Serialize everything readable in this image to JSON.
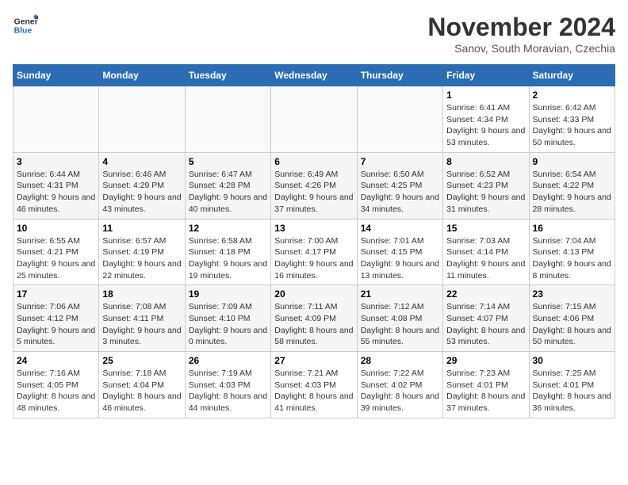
{
  "logo": {
    "general": "General",
    "blue": "Blue"
  },
  "title": "November 2024",
  "subtitle": "Sanov, South Moravian, Czechia",
  "days_of_week": [
    "Sunday",
    "Monday",
    "Tuesday",
    "Wednesday",
    "Thursday",
    "Friday",
    "Saturday"
  ],
  "weeks": [
    [
      {
        "day": "",
        "empty": true
      },
      {
        "day": "",
        "empty": true
      },
      {
        "day": "",
        "empty": true
      },
      {
        "day": "",
        "empty": true
      },
      {
        "day": "",
        "empty": true
      },
      {
        "day": "1",
        "sunrise": "6:41 AM",
        "sunset": "4:34 PM",
        "daylight": "9 hours and 53 minutes."
      },
      {
        "day": "2",
        "sunrise": "6:42 AM",
        "sunset": "4:33 PM",
        "daylight": "9 hours and 50 minutes."
      }
    ],
    [
      {
        "day": "3",
        "sunrise": "6:44 AM",
        "sunset": "4:31 PM",
        "daylight": "9 hours and 46 minutes."
      },
      {
        "day": "4",
        "sunrise": "6:46 AM",
        "sunset": "4:29 PM",
        "daylight": "9 hours and 43 minutes."
      },
      {
        "day": "5",
        "sunrise": "6:47 AM",
        "sunset": "4:28 PM",
        "daylight": "9 hours and 40 minutes."
      },
      {
        "day": "6",
        "sunrise": "6:49 AM",
        "sunset": "4:26 PM",
        "daylight": "9 hours and 37 minutes."
      },
      {
        "day": "7",
        "sunrise": "6:50 AM",
        "sunset": "4:25 PM",
        "daylight": "9 hours and 34 minutes."
      },
      {
        "day": "8",
        "sunrise": "6:52 AM",
        "sunset": "4:23 PM",
        "daylight": "9 hours and 31 minutes."
      },
      {
        "day": "9",
        "sunrise": "6:54 AM",
        "sunset": "4:22 PM",
        "daylight": "9 hours and 28 minutes."
      }
    ],
    [
      {
        "day": "10",
        "sunrise": "6:55 AM",
        "sunset": "4:21 PM",
        "daylight": "9 hours and 25 minutes."
      },
      {
        "day": "11",
        "sunrise": "6:57 AM",
        "sunset": "4:19 PM",
        "daylight": "9 hours and 22 minutes."
      },
      {
        "day": "12",
        "sunrise": "6:58 AM",
        "sunset": "4:18 PM",
        "daylight": "9 hours and 19 minutes."
      },
      {
        "day": "13",
        "sunrise": "7:00 AM",
        "sunset": "4:17 PM",
        "daylight": "9 hours and 16 minutes."
      },
      {
        "day": "14",
        "sunrise": "7:01 AM",
        "sunset": "4:15 PM",
        "daylight": "9 hours and 13 minutes."
      },
      {
        "day": "15",
        "sunrise": "7:03 AM",
        "sunset": "4:14 PM",
        "daylight": "9 hours and 11 minutes."
      },
      {
        "day": "16",
        "sunrise": "7:04 AM",
        "sunset": "4:13 PM",
        "daylight": "9 hours and 8 minutes."
      }
    ],
    [
      {
        "day": "17",
        "sunrise": "7:06 AM",
        "sunset": "4:12 PM",
        "daylight": "9 hours and 5 minutes."
      },
      {
        "day": "18",
        "sunrise": "7:08 AM",
        "sunset": "4:11 PM",
        "daylight": "9 hours and 3 minutes."
      },
      {
        "day": "19",
        "sunrise": "7:09 AM",
        "sunset": "4:10 PM",
        "daylight": "9 hours and 0 minutes."
      },
      {
        "day": "20",
        "sunrise": "7:11 AM",
        "sunset": "4:09 PM",
        "daylight": "8 hours and 58 minutes."
      },
      {
        "day": "21",
        "sunrise": "7:12 AM",
        "sunset": "4:08 PM",
        "daylight": "8 hours and 55 minutes."
      },
      {
        "day": "22",
        "sunrise": "7:14 AM",
        "sunset": "4:07 PM",
        "daylight": "8 hours and 53 minutes."
      },
      {
        "day": "23",
        "sunrise": "7:15 AM",
        "sunset": "4:06 PM",
        "daylight": "8 hours and 50 minutes."
      }
    ],
    [
      {
        "day": "24",
        "sunrise": "7:16 AM",
        "sunset": "4:05 PM",
        "daylight": "8 hours and 48 minutes."
      },
      {
        "day": "25",
        "sunrise": "7:18 AM",
        "sunset": "4:04 PM",
        "daylight": "8 hours and 46 minutes."
      },
      {
        "day": "26",
        "sunrise": "7:19 AM",
        "sunset": "4:03 PM",
        "daylight": "8 hours and 44 minutes."
      },
      {
        "day": "27",
        "sunrise": "7:21 AM",
        "sunset": "4:03 PM",
        "daylight": "8 hours and 41 minutes."
      },
      {
        "day": "28",
        "sunrise": "7:22 AM",
        "sunset": "4:02 PM",
        "daylight": "8 hours and 39 minutes."
      },
      {
        "day": "29",
        "sunrise": "7:23 AM",
        "sunset": "4:01 PM",
        "daylight": "8 hours and 37 minutes."
      },
      {
        "day": "30",
        "sunrise": "7:25 AM",
        "sunset": "4:01 PM",
        "daylight": "8 hours and 36 minutes."
      }
    ]
  ]
}
